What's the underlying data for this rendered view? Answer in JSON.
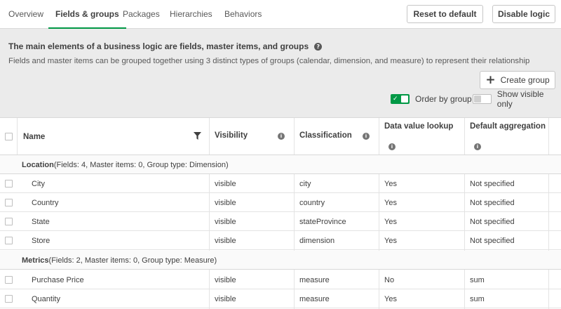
{
  "tabs": [
    {
      "label": "Overview",
      "active": false
    },
    {
      "label": "Fields & groups",
      "active": true
    },
    {
      "label": "Packages",
      "active": false
    },
    {
      "label": "Hierarchies",
      "active": false
    },
    {
      "label": "Behaviors",
      "active": false
    }
  ],
  "toolbar": {
    "reset_label": "Reset to default",
    "disable_label": "Disable logic"
  },
  "description": {
    "title": "The main elements of a business logic are fields, master items, and groups",
    "subtitle": "Fields and master items can be grouped together using 3 distinct types of groups (calendar, dimension, and measure) to represent their relationship"
  },
  "create_group": {
    "label": "Create group",
    "icon": "plus-icon"
  },
  "toggles": {
    "order_by_group": {
      "label": "Order by group",
      "on": true
    },
    "show_visible_only": {
      "label": "Show visible only",
      "on": false
    }
  },
  "table": {
    "headers": {
      "name": "Name",
      "visibility": "Visibility",
      "classification": "Classification",
      "lookup": "Data value lookup",
      "aggregation": "Default aggregation"
    },
    "groups": [
      {
        "name": "Location",
        "meta": "(Fields: 4, Master items: 0, Group type: Dimension)",
        "rows": [
          {
            "name": "City",
            "visibility": "visible",
            "classification": "city",
            "lookup": "Yes",
            "aggregation": "Not specified"
          },
          {
            "name": "Country",
            "visibility": "visible",
            "classification": "country",
            "lookup": "Yes",
            "aggregation": "Not specified"
          },
          {
            "name": "State",
            "visibility": "visible",
            "classification": "stateProvince",
            "lookup": "Yes",
            "aggregation": "Not specified"
          },
          {
            "name": "Store",
            "visibility": "visible",
            "classification": "dimension",
            "lookup": "Yes",
            "aggregation": "Not specified"
          }
        ]
      },
      {
        "name": "Metrics",
        "meta": "(Fields: 2, Master items: 0, Group type: Measure)",
        "rows": [
          {
            "name": "Purchase Price",
            "visibility": "visible",
            "classification": "measure",
            "lookup": "No",
            "aggregation": "sum"
          },
          {
            "name": "Quantity",
            "visibility": "visible",
            "classification": "measure",
            "lookup": "Yes",
            "aggregation": "sum"
          }
        ]
      }
    ]
  },
  "colors": {
    "accent": "#009845",
    "panel_bg": "#ebebeb"
  }
}
